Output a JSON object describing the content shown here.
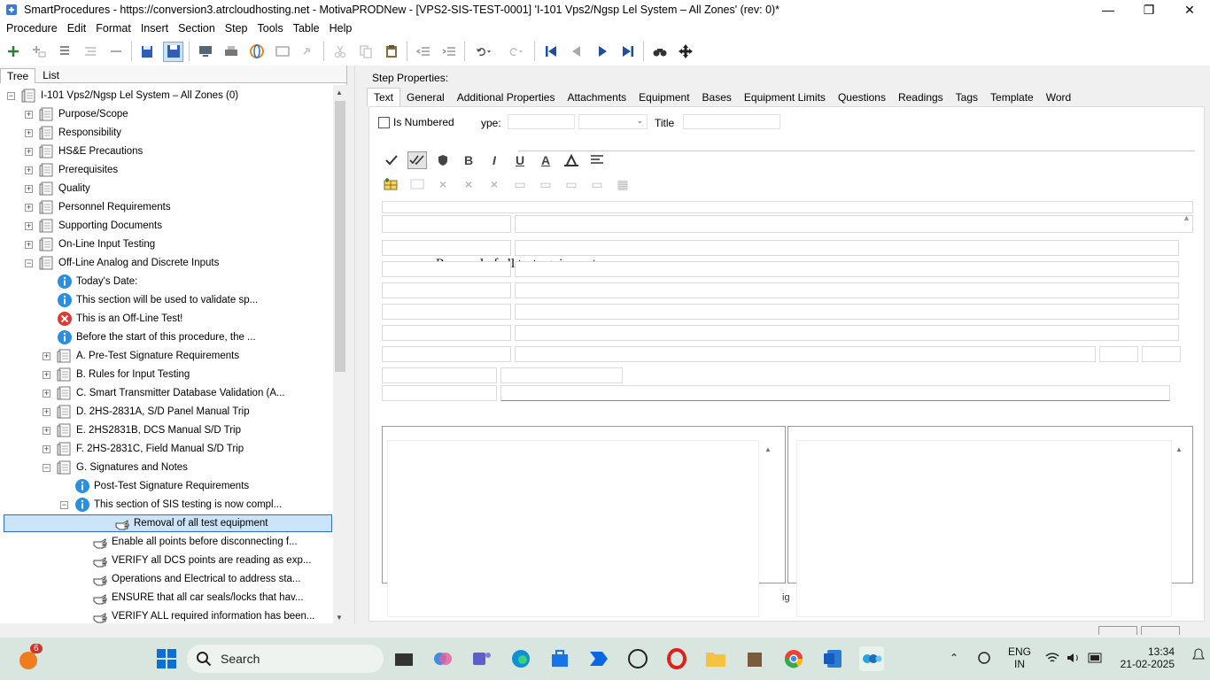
{
  "window": {
    "title": "SmartProcedures - https://conversion3.atrcloudhosting.net - MotivaPRODNew - [VPS2-SIS-TEST-0001] 'I-101 Vps2/Ngsp Lel System – All Zones' (rev: 0)*",
    "minimize": "—",
    "maximize": "❐",
    "close": "✕"
  },
  "menu": [
    "Procedure",
    "Edit",
    "Format",
    "Insert",
    "Section",
    "Step",
    "Tools",
    "Table",
    "Help"
  ],
  "left_tabs": [
    "Tree",
    "List"
  ],
  "tree": {
    "root": "I-101 Vps2/Ngsp Lel System – All Zones (0)",
    "items": [
      {
        "label": "Purpose/Scope",
        "level": 1,
        "icon": "section",
        "exp": "+"
      },
      {
        "label": "Responsibility",
        "level": 1,
        "icon": "section",
        "exp": "+"
      },
      {
        "label": "HS&E Precautions",
        "level": 1,
        "icon": "section",
        "exp": "+"
      },
      {
        "label": "Prerequisites",
        "level": 1,
        "icon": "section",
        "exp": "+"
      },
      {
        "label": "Quality",
        "level": 1,
        "icon": "section",
        "exp": "+"
      },
      {
        "label": "Personnel Requirements",
        "level": 1,
        "icon": "section",
        "exp": "+"
      },
      {
        "label": "Supporting Documents",
        "level": 1,
        "icon": "section",
        "exp": "+"
      },
      {
        "label": "On-Line Input Testing",
        "level": 1,
        "icon": "section",
        "exp": "+"
      },
      {
        "label": "Off-Line Analog and Discrete Inputs",
        "level": 1,
        "icon": "section",
        "exp": "−"
      },
      {
        "label": "Today's Date:",
        "level": 2,
        "icon": "info",
        "exp": ""
      },
      {
        "label": "This section will be used to validate sp...",
        "level": 2,
        "icon": "info",
        "exp": ""
      },
      {
        "label": "This is an Off-Line Test!",
        "level": 2,
        "icon": "warning",
        "exp": ""
      },
      {
        "label": "Before the start of this procedure, the ...",
        "level": 2,
        "icon": "info",
        "exp": ""
      },
      {
        "label": "A. Pre-Test Signature Requirements",
        "level": 2,
        "icon": "section",
        "exp": "+"
      },
      {
        "label": "B. Rules for Input Testing",
        "level": 2,
        "icon": "section",
        "exp": "+"
      },
      {
        "label": "C. Smart Transmitter Database Validation (A...",
        "level": 2,
        "icon": "section",
        "exp": "+"
      },
      {
        "label": "D. 2HS-2831A, S/D Panel Manual Trip",
        "level": 2,
        "icon": "section",
        "exp": "+"
      },
      {
        "label": "E. 2HS2831B, DCS Manual S/D Trip",
        "level": 2,
        "icon": "section",
        "exp": "+"
      },
      {
        "label": "F. 2HS-2831C, Field Manual S/D Trip",
        "level": 2,
        "icon": "section",
        "exp": "+"
      },
      {
        "label": "G. Signatures and Notes",
        "level": 2,
        "icon": "section",
        "exp": "−"
      },
      {
        "label": "Post-Test Signature Requirements",
        "level": 3,
        "icon": "info",
        "exp": ""
      },
      {
        "label": "This section of SIS testing is now compl...",
        "level": 3,
        "icon": "info",
        "exp": "−"
      },
      {
        "label": "Removal of all test equipment",
        "level": 4,
        "icon": "step",
        "exp": "",
        "selected": true
      },
      {
        "label": "Enable all points before disconnecting f...",
        "level": 4,
        "icon": "step",
        "exp": ""
      },
      {
        "label": "VERIFY all DCS points are reading as exp...",
        "level": 4,
        "icon": "step",
        "exp": ""
      },
      {
        "label": "Operations and Electrical to address sta...",
        "level": 4,
        "icon": "step",
        "exp": ""
      },
      {
        "label": "ENSURE that all car seals/locks that hav...",
        "level": 4,
        "icon": "step",
        "exp": ""
      },
      {
        "label": "VERIFY ALL required information has been...",
        "level": 4,
        "icon": "step",
        "exp": ""
      }
    ]
  },
  "step_props": {
    "label": "Step Properties:",
    "tabs": [
      "Text",
      "General",
      "Additional Properties",
      "Attachments",
      "Equipment",
      "Bases",
      "Equipment Limits",
      "Questions",
      "Readings",
      "Tags",
      "Template",
      "Word"
    ],
    "is_numbered": "Is Numbered",
    "type_label": "ype:",
    "title_label": "Title",
    "editor_bold": "B",
    "editor_italic": "I",
    "editor_underline": "U",
    "editor_fontcolor": "A",
    "bullet_text": "Removal of all test equipment",
    "fragment": "ig"
  },
  "taskbar": {
    "search": "Search",
    "badge": "6",
    "lang_1": "ENG",
    "lang_2": "IN",
    "time": "13:34",
    "date": "21-02-2025"
  },
  "colors": {
    "selection_bg": "#cce4f7",
    "selection_border": "#2a6ecf",
    "info_blue": "#2b8fe0",
    "warn_red": "#e03a2f",
    "nav_blue": "#1e4f9c"
  }
}
